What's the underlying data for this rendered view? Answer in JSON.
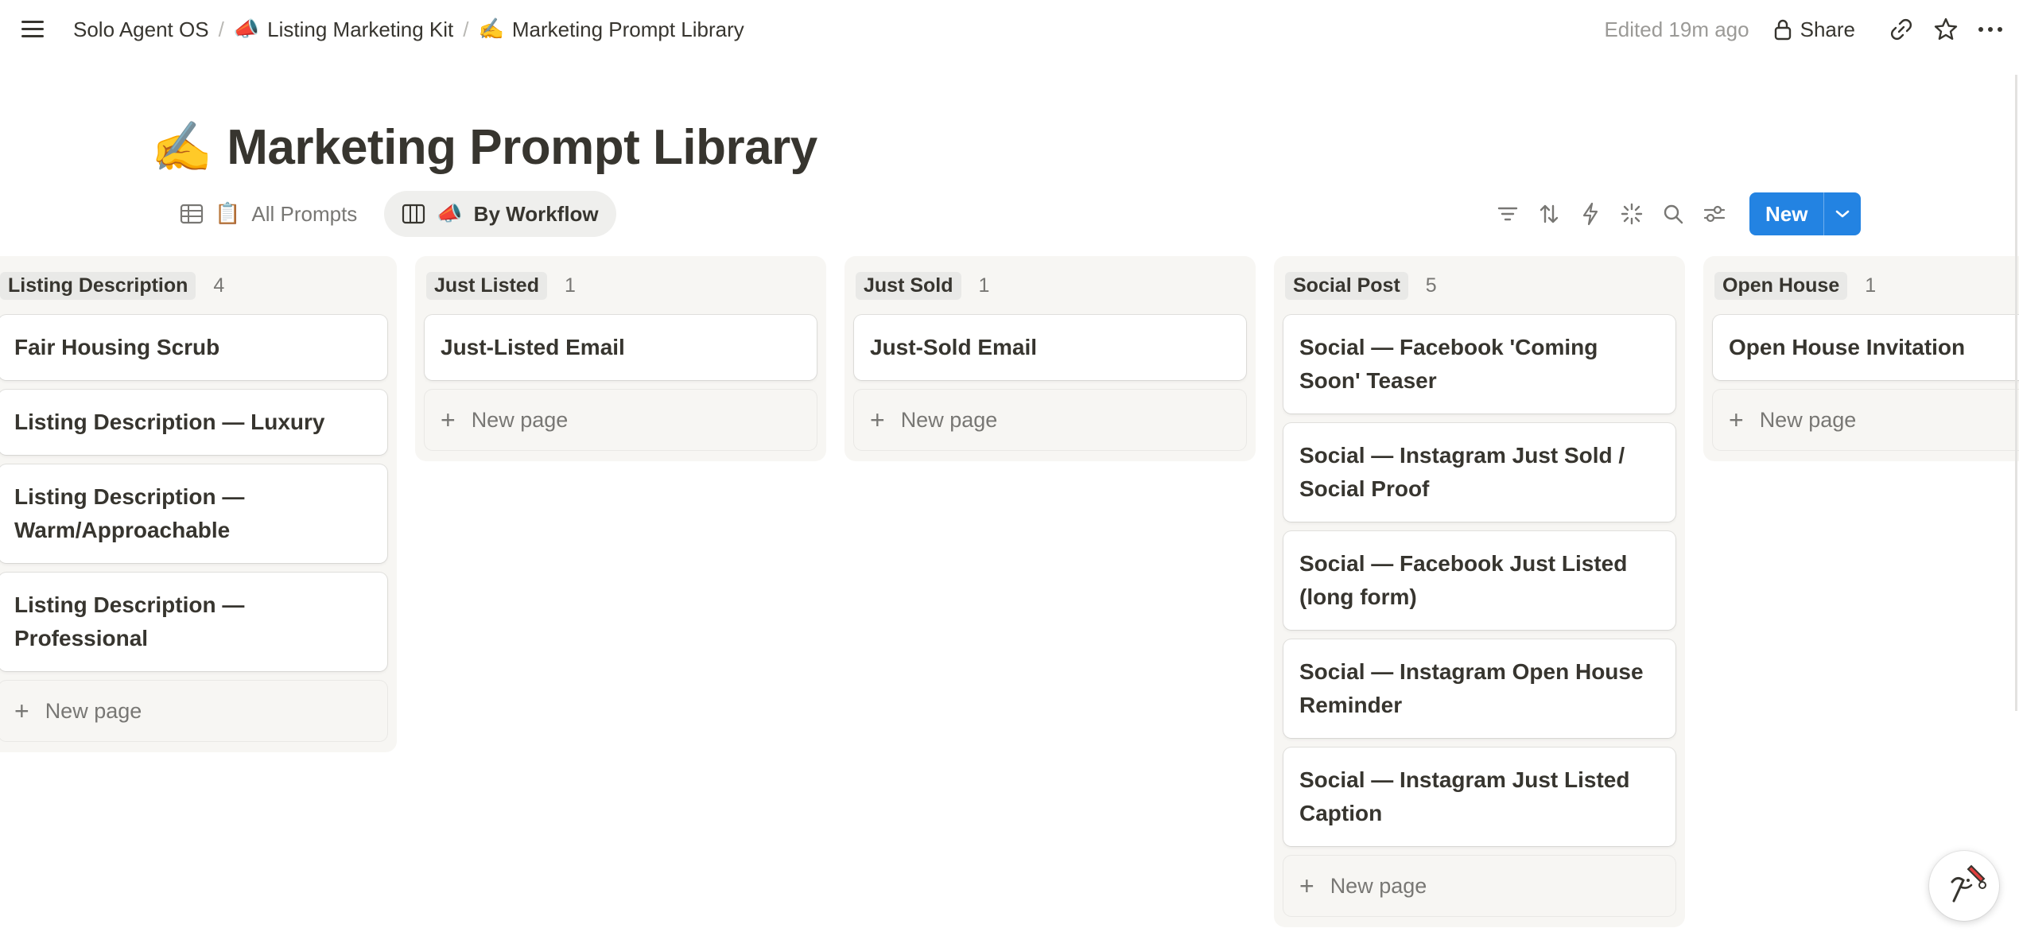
{
  "topbar": {
    "breadcrumbs": [
      {
        "emoji": "",
        "label": "Solo Agent OS"
      },
      {
        "emoji": "📣",
        "label": "Listing Marketing Kit"
      },
      {
        "emoji": "✍️",
        "label": "Marketing Prompt Library"
      }
    ],
    "edited": "Edited 19m ago",
    "share_label": "Share"
  },
  "page": {
    "emoji": "✍️",
    "title": "Marketing Prompt Library"
  },
  "views": [
    {
      "emoji": "📋",
      "label": "All Prompts",
      "active": false
    },
    {
      "emoji": "📣",
      "label": "By Workflow",
      "active": true
    }
  ],
  "toolbar": {
    "new_label": "New",
    "accent": "#2383e2"
  },
  "board": {
    "columns": [
      {
        "name": "Listing Description",
        "count": "4",
        "cards": [
          "Fair Housing Scrub",
          "Listing Description — Luxury",
          "Listing Description — Warm/Approachable",
          "Listing Description — Professional"
        ],
        "new_page": "New page"
      },
      {
        "name": "Just Listed",
        "count": "1",
        "cards": [
          "Just-Listed Email"
        ],
        "new_page": "New page"
      },
      {
        "name": "Just Sold",
        "count": "1",
        "cards": [
          "Just-Sold Email"
        ],
        "new_page": "New page"
      },
      {
        "name": "Social Post",
        "count": "5",
        "cards": [
          "Social — Facebook 'Coming Soon' Teaser",
          "Social — Instagram Just Sold / Social Proof",
          "Social — Facebook Just Listed (long form)",
          "Social — Instagram Open House Reminder",
          "Social — Instagram Just Listed Caption"
        ],
        "new_page": "New page"
      },
      {
        "name": "Open House",
        "count": "1",
        "cards": [
          "Open House Invitation"
        ],
        "new_page": "New page"
      }
    ]
  },
  "icons": {
    "menu": "hamburger-icon",
    "lock": "lock-icon",
    "link": "link-icon",
    "star": "star-icon",
    "more": "more-icon",
    "table": "table-view-icon",
    "board": "board-view-icon",
    "filter": "filter-icon",
    "sort": "sort-icon",
    "automation": "lightning-icon",
    "ai": "sparkle-icon",
    "search": "search-icon",
    "settings": "sliders-icon",
    "caret": "chevron-down-icon"
  }
}
